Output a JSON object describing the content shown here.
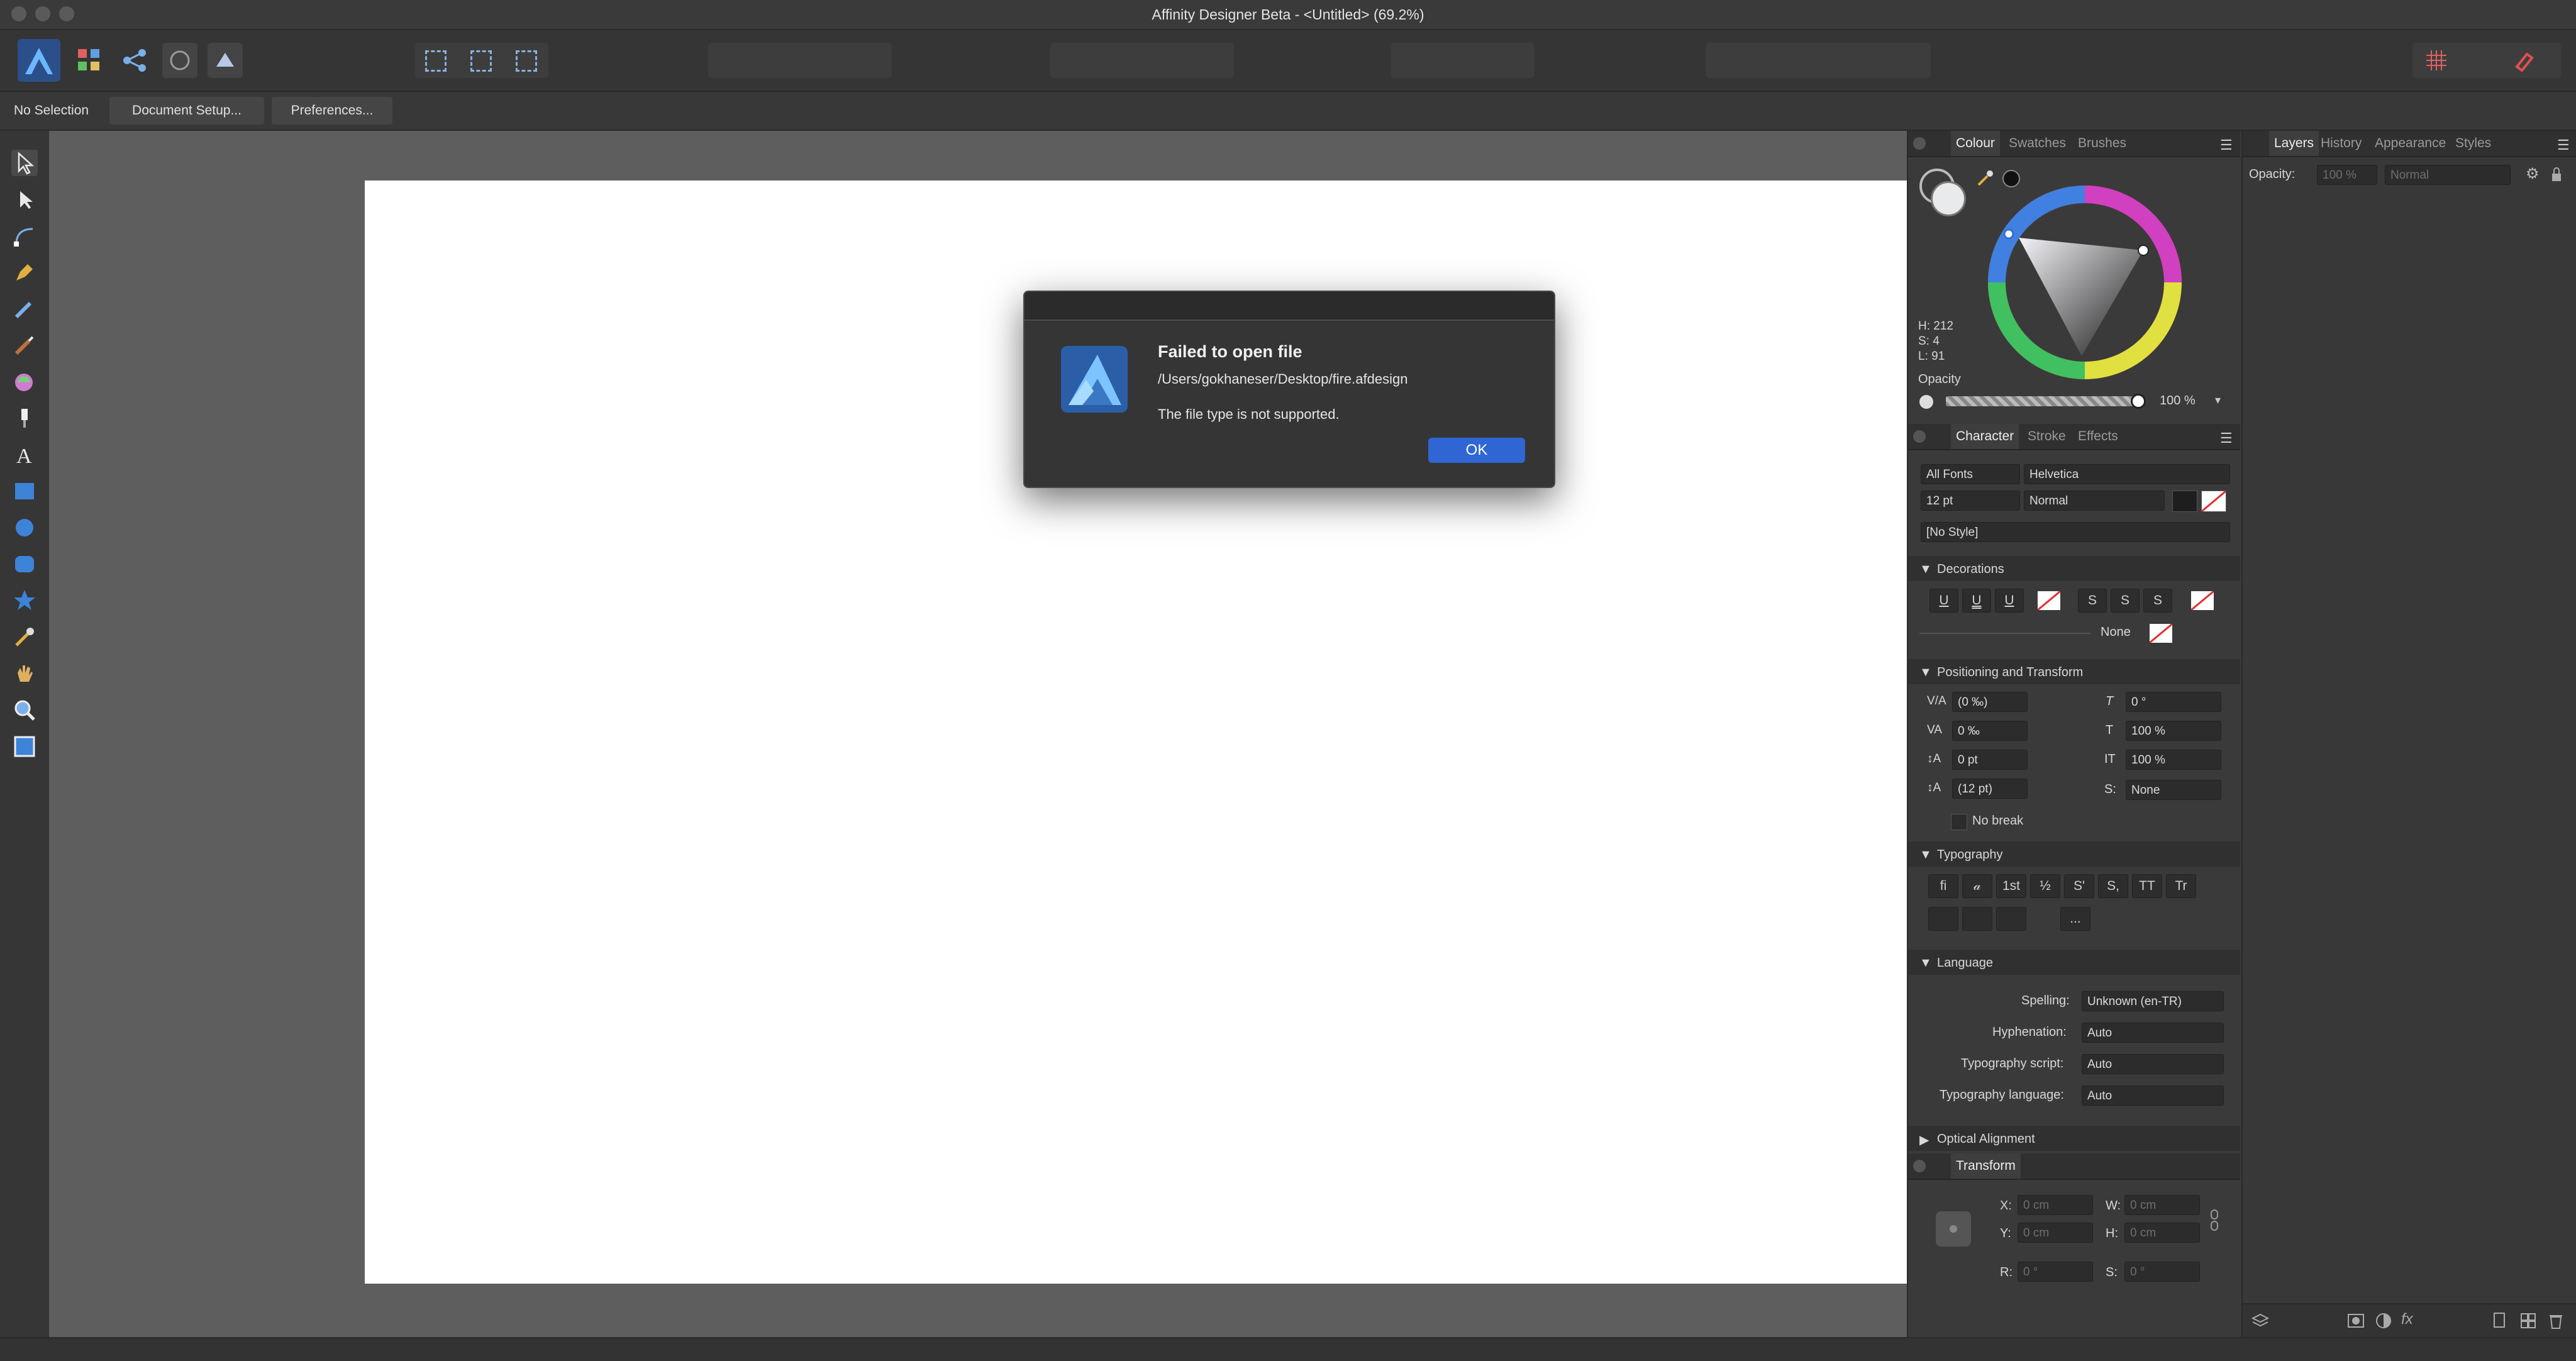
{
  "window": {
    "title": "Affinity Designer Beta - <Untitled> (69.2%)"
  },
  "context_bar": {
    "selection": "No Selection",
    "document_setup": "Document Setup...",
    "preferences": "Preferences..."
  },
  "dialog": {
    "title": "Failed to open file",
    "path": "/Users/gokhaneser/Desktop/fire.afdesign",
    "message": "The file type is not supported.",
    "ok": "OK"
  },
  "colour_panel": {
    "tabs": [
      "Colour",
      "Swatches",
      "Brushes"
    ],
    "h": "H: 212",
    "s": "S: 4",
    "l": "L: 91",
    "opacity_label": "Opacity",
    "opacity_value": "100 %"
  },
  "character_panel": {
    "tabs": [
      "Character",
      "Stroke",
      "Effects"
    ],
    "font_collection": "All Fonts",
    "font_family": "Helvetica",
    "font_size": "12 pt",
    "font_style": "Normal",
    "paragraph_style": "[No Style]",
    "decorations": {
      "title": "Decorations",
      "none_label": "None",
      "buttons": [
        "U",
        "U",
        "U",
        "S",
        "S",
        "S"
      ]
    },
    "positioning": {
      "title": "Positioning and Transform",
      "kerning": "(0 ‰)",
      "tracking": "0 ‰",
      "baseline": "0 pt",
      "leading": "(12 pt)",
      "shear": "0 °",
      "vscale": "100 %",
      "hscale": "100 %",
      "sscale": "None",
      "no_break": "No break"
    },
    "typography": {
      "title": "Typography",
      "row1": [
        "fi",
        "𝒶",
        "1st",
        "½",
        "S'",
        "S,",
        "TT",
        "Tr"
      ],
      "more": "..."
    },
    "language": {
      "title": "Language",
      "spelling_label": "Spelling:",
      "spelling": "Unknown (en-TR)",
      "hyphenation_label": "Hyphenation:",
      "hyphenation": "Auto",
      "script_label": "Typography script:",
      "script": "Auto",
      "lang_label": "Typography language:",
      "lang": "Auto"
    },
    "optical": "Optical Alignment"
  },
  "transform_panel": {
    "title": "Transform",
    "x_label": "X:",
    "x": "0 cm",
    "y_label": "Y:",
    "y": "0 cm",
    "w_label": "W:",
    "w": "0 cm",
    "h_label": "H:",
    "h": "0 cm",
    "r_label": "R:",
    "r": "0 °",
    "s_label": "S:",
    "s": "0 °"
  },
  "layers_panel": {
    "tabs": [
      "Layers",
      "History",
      "Appearance",
      "Styles"
    ],
    "opacity_label": "Opacity:",
    "opacity": "100 %",
    "blend": "Normal"
  },
  "colors": {
    "accent": "#3a6fd8",
    "ok_button": "#2f66d4",
    "wheel_center": "#1a1a1a"
  }
}
